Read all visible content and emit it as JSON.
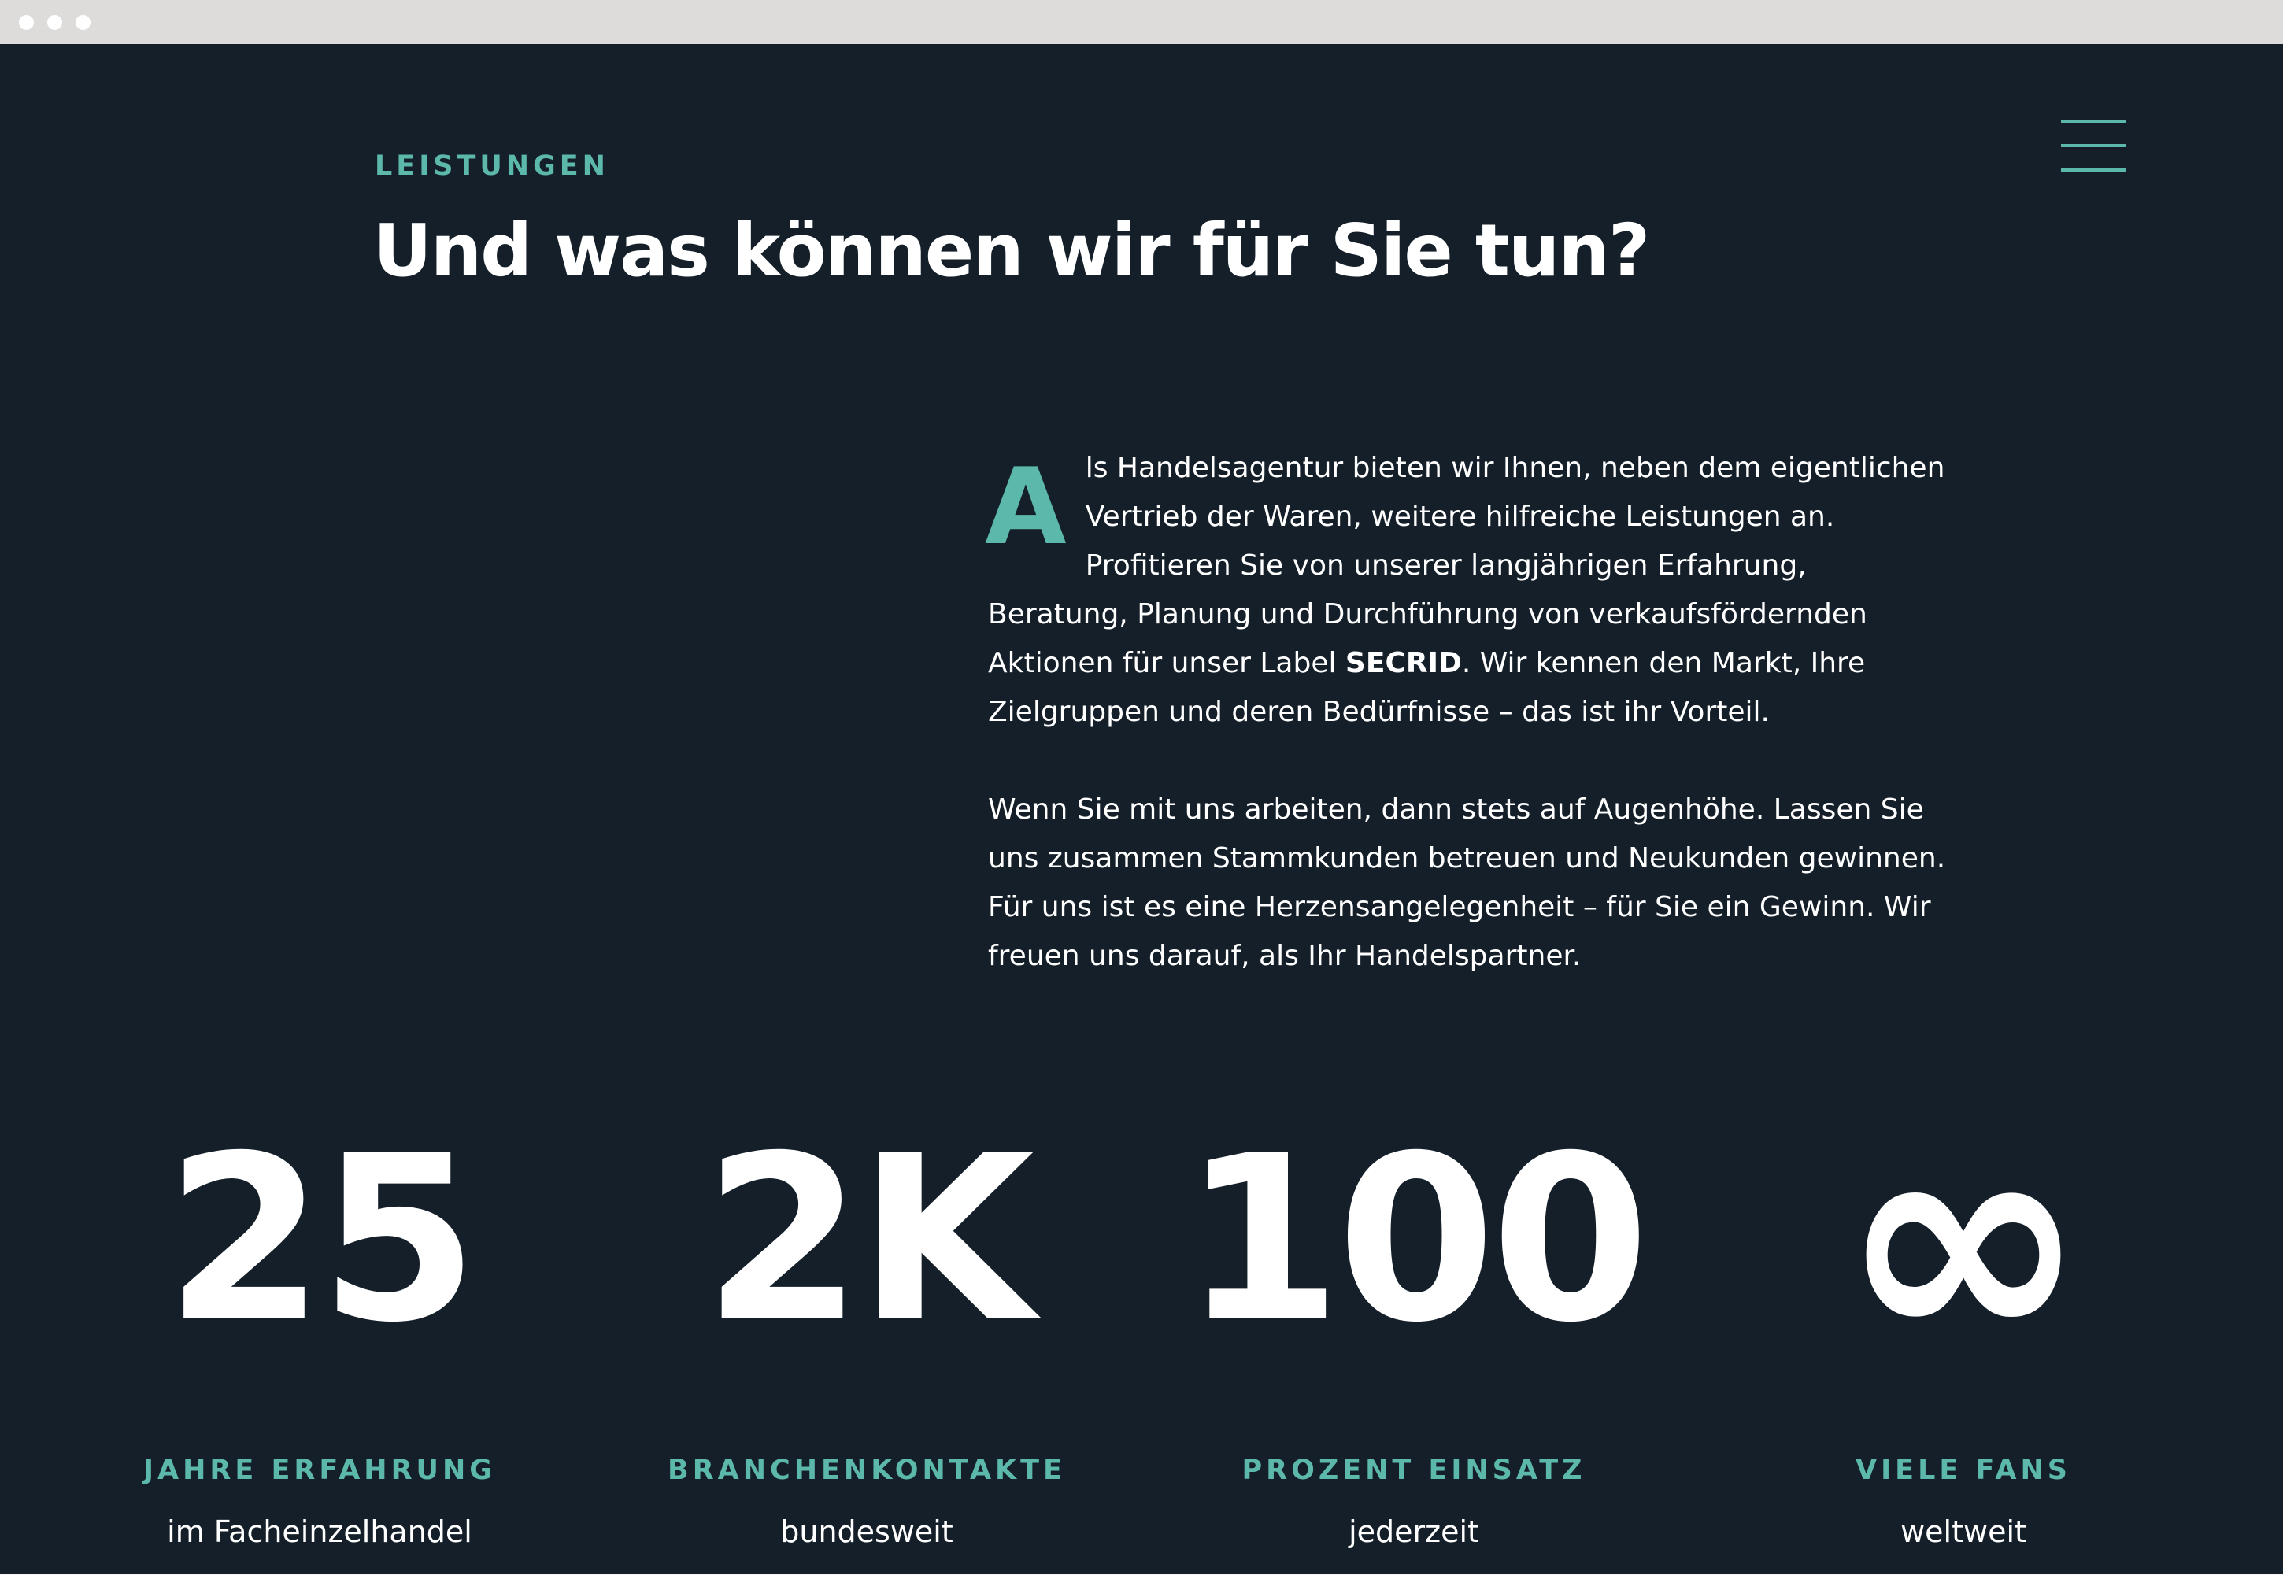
{
  "colors": {
    "background": "#141f29",
    "accent": "#5cb8aa",
    "text": "#ffffff",
    "titlebar": "#dedcdb"
  },
  "header": {
    "menu_icon": "hamburger-menu-icon"
  },
  "section": {
    "eyebrow": "LEISTUNGEN",
    "title": "Und was können wir für Sie tun?"
  },
  "intro": {
    "dropcap": "A",
    "p1_start": "ls Handelsagentur bieten wir Ihnen, neben dem eigentlichen Vertrieb der Waren, weitere hilfreiche Leistungen an. Profitieren Sie von unserer langjährigen Erfahrung, Beratung, Planung und Durchführung von verkaufsfördernden Aktionen für unser Label ",
    "p1_brand": "SECRID",
    "p1_end": ". Wir kennen den Markt, Ihre Zielgruppen und deren Bedürfnisse – das ist ihr Vorteil.",
    "p2": "Wenn Sie mit uns arbeiten, dann stets auf Augenhöhe. Lassen Sie uns zusammen Stammkunden betreuen und Neukunden gewinnen. Für uns ist es eine Herzensangelegenheit – für Sie ein Gewinn. Wir freuen uns darauf, als Ihr Handelspartner."
  },
  "stats": [
    {
      "value": "25",
      "label": "JAHRE ERFAHRUNG",
      "sub": "im Facheinzelhandel"
    },
    {
      "value": "2K",
      "label": "BRANCHENKONTAKTE",
      "sub": "bundesweit"
    },
    {
      "value": "100",
      "label": "PROZENT EINSATZ",
      "sub": "jederzeit"
    },
    {
      "value": "∞",
      "label": "VIELE FANS",
      "sub": "weltweit"
    }
  ]
}
